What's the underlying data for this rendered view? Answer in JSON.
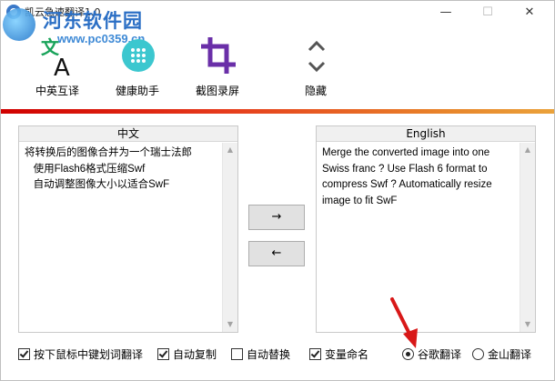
{
  "window": {
    "title": "凯云急速翻译1.0",
    "controls": {
      "minimize": "—",
      "maximize": "☐",
      "close": "✕"
    }
  },
  "watermark": {
    "title": "河东软件园",
    "url": "www.pc0359.cn"
  },
  "toolbar": {
    "items": [
      {
        "label": "中英互译",
        "icon": "translate-icon"
      },
      {
        "label": "健康助手",
        "icon": "health-assistant-icon"
      },
      {
        "label": "截图录屏",
        "icon": "crop-icon"
      },
      {
        "label": "隐藏",
        "icon": "collapse-expand-icon"
      }
    ]
  },
  "colors": {
    "divider_start": "#d00000",
    "divider_end": "#eaa23b",
    "accent": "#6a2fa8",
    "translate_green": "#19a35a"
  },
  "left_pane": {
    "header": "中文",
    "text": "将转换后的图像合并为一个瑞士法郎\n   使用Flash6格式压缩Swf\n   自动调整图像大小以适合SwF"
  },
  "right_pane": {
    "header": "English",
    "text": "Merge the converted image into one Swiss franc ? Use Flash 6 format to compress Swf ? Automatically resize image to fit SwF"
  },
  "buttons": {
    "to_english": "→",
    "to_chinese": "←"
  },
  "options": {
    "hotkey": {
      "label": "按下鼠标中键划词翻译",
      "checked": true
    },
    "auto_copy": {
      "label": "自动复制",
      "checked": true
    },
    "auto_replace": {
      "label": "自动替换",
      "checked": false
    },
    "variable_naming": {
      "label": "变量命名",
      "checked": true
    },
    "google": {
      "label": "谷歌翻译",
      "selected": true
    },
    "kingsoft": {
      "label": "金山翻译",
      "selected": false
    }
  }
}
